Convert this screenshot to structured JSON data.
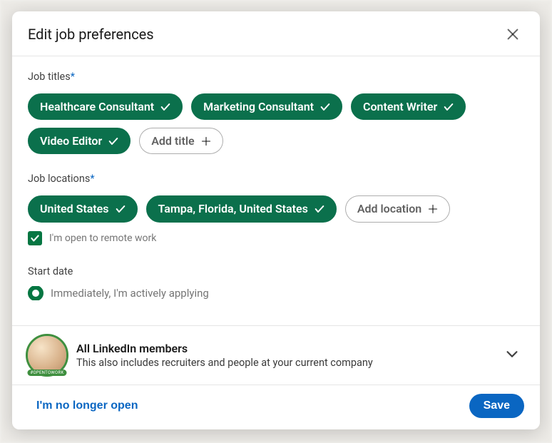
{
  "modal": {
    "title": "Edit job preferences",
    "sections": {
      "job_titles": {
        "label": "Job titles",
        "required_marker": "*",
        "chips": [
          {
            "label": "Healthcare Consultant"
          },
          {
            "label": "Marketing Consultant"
          },
          {
            "label": "Content Writer"
          },
          {
            "label": "Video Editor"
          }
        ],
        "add_label": "Add title"
      },
      "job_locations": {
        "label": "Job locations",
        "required_marker": "*",
        "chips": [
          {
            "label": "United States"
          },
          {
            "label": "Tampa, Florida, United States"
          }
        ],
        "add_label": "Add location",
        "remote_label": "I'm open to remote work",
        "remote_checked": true
      },
      "start_date": {
        "label": "Start date",
        "option_label": "Immediately, I'm actively applying"
      }
    },
    "visibility": {
      "title": "All LinkedIn members",
      "subtitle": "This also includes recruiters and people at your current company",
      "frame_badge": "#OPENTOWORK"
    },
    "footer": {
      "secondary": "I'm no longer open",
      "primary": "Save"
    }
  }
}
